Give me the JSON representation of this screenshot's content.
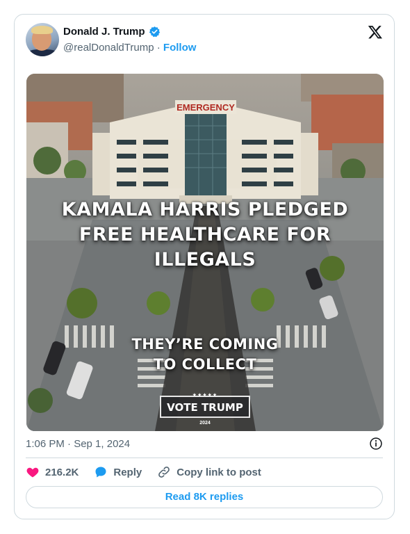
{
  "author": {
    "name": "Donald J. Trump",
    "handle": "@realDonaldTrump",
    "separator": "·",
    "follow_label": "Follow"
  },
  "media": {
    "sign_text": "EMERGENCY",
    "headline_lines": [
      "KAMALA HARRIS PLEDGED",
      "FREE HEALTHCARE FOR",
      "ILLEGALS"
    ],
    "subhead_lines": [
      "THEY’RE COMING",
      "TO COLLECT"
    ],
    "badge_stars": "★★★★★",
    "badge_text": "VOTE TRUMP",
    "badge_year": "2024"
  },
  "timestamp": "1:06 PM · Sep 1, 2024",
  "actions": {
    "likes": "216.2K",
    "reply": "Reply",
    "copy_link": "Copy link to post"
  },
  "read_replies": "Read 8K replies",
  "colors": {
    "accent": "#1d9bf0",
    "like": "#f91880",
    "muted": "#536471",
    "border": "#cfd9de"
  }
}
